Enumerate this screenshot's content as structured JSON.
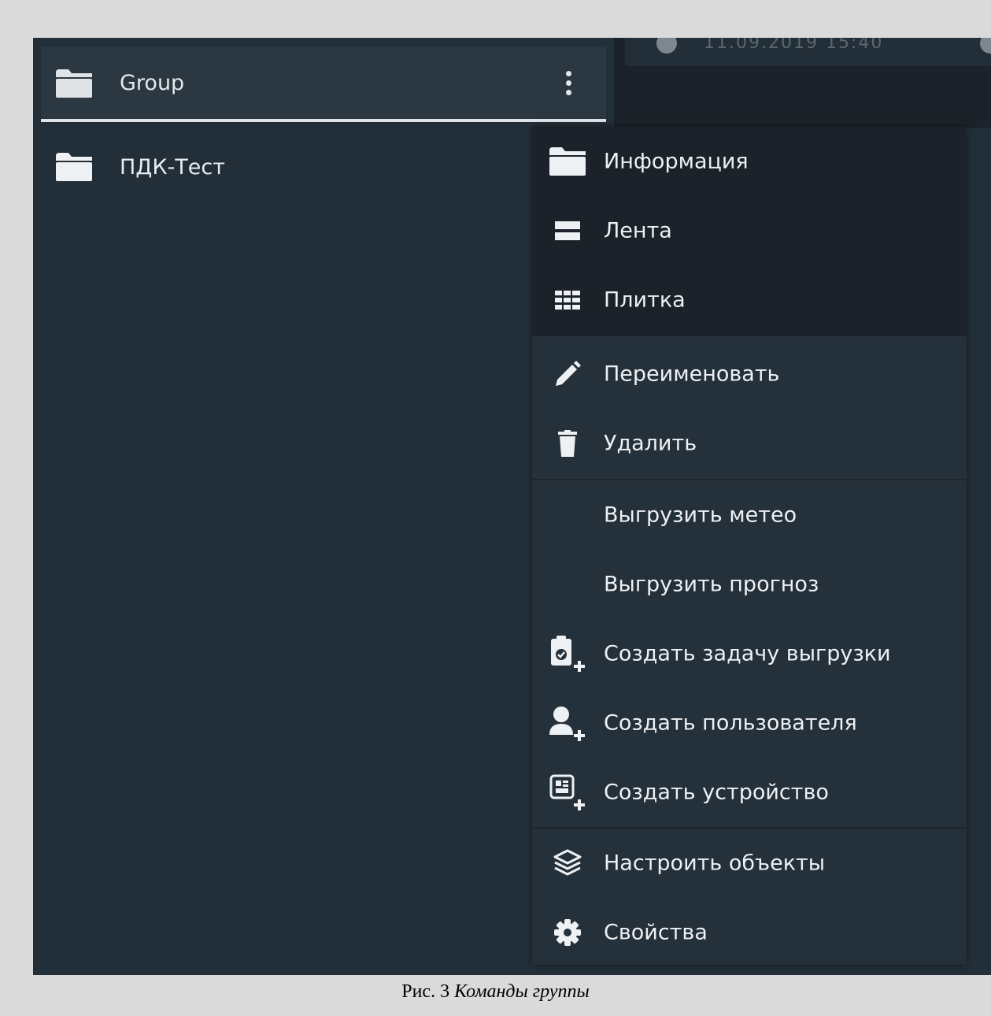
{
  "top_right": {
    "timestamp": "11.09.2019 15:40"
  },
  "tree": {
    "items": [
      {
        "label": "Group",
        "icon": "folder-icon",
        "selected": true
      },
      {
        "label": "ПДК-Тест",
        "icon": "folder-icon",
        "selected": false
      }
    ],
    "more_icon": "vertical-dots-icon"
  },
  "context_menu": {
    "items": [
      {
        "label": "Информация",
        "icon": "folder-icon"
      },
      {
        "label": "Лента",
        "icon": "list-view-icon"
      },
      {
        "label": "Плитка",
        "icon": "grid-view-icon"
      },
      {
        "label": "Переименовать",
        "icon": "pencil-icon"
      },
      {
        "label": "Удалить",
        "icon": "trash-icon"
      },
      {
        "label": "Выгрузить метео",
        "icon": ""
      },
      {
        "label": "Выгрузить прогноз",
        "icon": ""
      },
      {
        "label": "Создать задачу выгрузки",
        "icon": "clipboard-add-icon"
      },
      {
        "label": "Создать пользователя",
        "icon": "user-add-icon"
      },
      {
        "label": "Создать устройство",
        "icon": "device-add-icon"
      },
      {
        "label": "Настроить объекты",
        "icon": "layers-icon"
      },
      {
        "label": "Свойства",
        "icon": "gear-icon"
      }
    ]
  },
  "caption": {
    "prefix": "Рис. 3 ",
    "title": "Команды группы"
  },
  "colors": {
    "background": "#232f38",
    "menu_dark": "#1b2229",
    "text": "#eef1f3",
    "page": "#dadada"
  }
}
